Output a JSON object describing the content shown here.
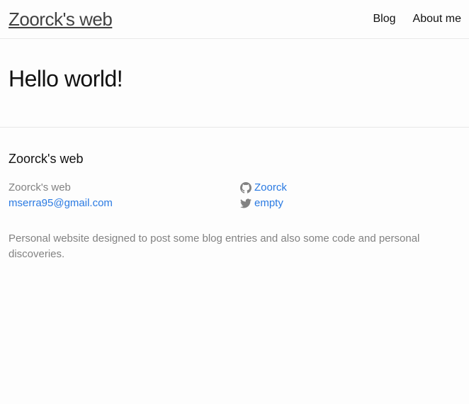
{
  "header": {
    "site_title": "Zoorck's web",
    "nav": [
      {
        "label": "Blog"
      },
      {
        "label": "About me"
      }
    ]
  },
  "main": {
    "heading": "Hello world!"
  },
  "footer": {
    "heading": "Zoorck's web",
    "contact": {
      "name": "Zoorck's web",
      "email": "mserra95@gmail.com"
    },
    "social": {
      "github": {
        "icon": "github-icon",
        "username": "Zoorck"
      },
      "twitter": {
        "icon": "twitter-icon",
        "username": "empty"
      }
    },
    "description": "Personal website designed to post some blog entries and also some code and personal discoveries."
  },
  "colors": {
    "link": "#2a7ae2",
    "muted": "#828282",
    "text": "#111111",
    "border": "#e8e8e8"
  }
}
